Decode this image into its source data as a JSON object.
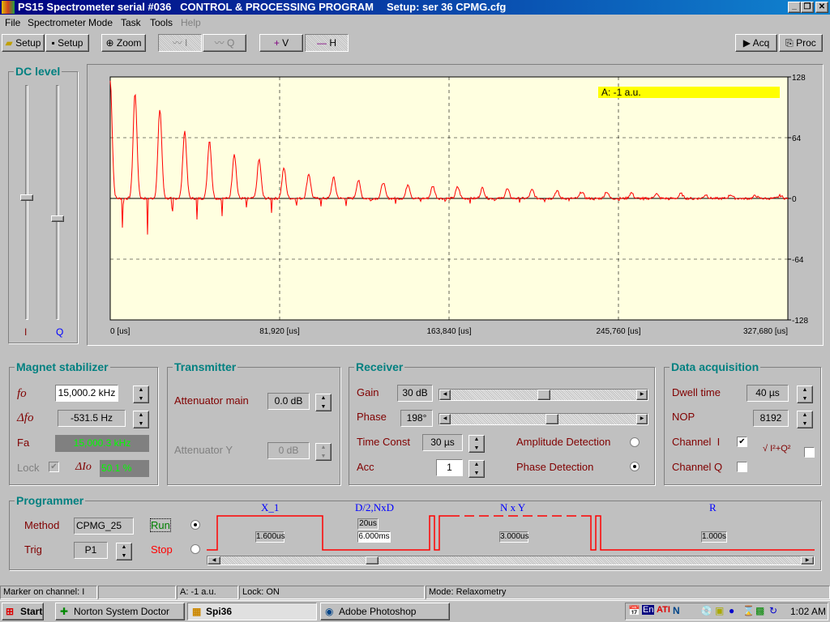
{
  "window": {
    "title": "PS15 Spectrometer serial #036   CONTROL & PROCESSING PROGRAM",
    "setup": "Setup: ser 36 CPMG.cfg",
    "controls": [
      "_",
      "❐",
      "✕"
    ]
  },
  "menu": [
    "File",
    "Spectrometer",
    "Mode",
    "Task",
    "Tools",
    "Help"
  ],
  "toolbar": {
    "open_setup": "Setup",
    "save_setup": "Setup",
    "zoom": "Zoom",
    "channel_i": "I",
    "channel_q": "Q",
    "cursor_v": "V",
    "cursor_h": "H",
    "acq": "Acq",
    "proc": "Proc"
  },
  "dc_level": {
    "title": "DC level",
    "i_label": "I",
    "q_label": "Q",
    "i_level": 0.48,
    "q_level": 0.57
  },
  "chart_data": {
    "type": "line",
    "xlim": [
      0,
      327680
    ],
    "ylim": [
      -128,
      128
    ],
    "x_ticks": [
      "0 [us]",
      "81,920 [us]",
      "163,840 [us]",
      "245,760 [us]",
      "327,680 [us]"
    ],
    "y_ticks": [
      "128",
      "64",
      "0",
      "-64",
      "-128"
    ],
    "grid": true,
    "marker_readout": "A: -1 a.u.",
    "echo_spacing_us": 12000,
    "echo_amplitudes": [
      124,
      111,
      94,
      71,
      61,
      47,
      41,
      32,
      26,
      22,
      19,
      17,
      15,
      13,
      12,
      11,
      10,
      9,
      8,
      7,
      7,
      6,
      5,
      5,
      4,
      4,
      3,
      3
    ],
    "colors": {
      "trace": "#ff0000",
      "background": "#ffffe0",
      "marker": "#ffff00"
    }
  },
  "magnet": {
    "title": "Magnet stabilizer",
    "fo_label": "fo",
    "fo": "15,000.2 kHz",
    "dfo_label": "Δfo",
    "dfo": "-531.5 Hz",
    "fa_label": "Fa",
    "fa": "15,000.3 kHz",
    "lock_label": "Lock",
    "dio_label": "ΔIo",
    "dio": "50.1 %"
  },
  "transmitter": {
    "title": "Transmitter",
    "att_main_label": "Attenuator main",
    "att_main": "0.0 dB",
    "att_y_label": "Attenuator Y",
    "att_y": "0 dB"
  },
  "receiver": {
    "title": "Receiver",
    "gain_label": "Gain",
    "gain": "30 dB",
    "gain_pos": 0.5,
    "phase_label": "Phase",
    "phase": "198°",
    "phase_pos": 0.55,
    "tc_label": "Time Const",
    "tc": "30 µs",
    "acc_label": "Acc",
    "acc": "1",
    "amp_det": "Amplitude Detection",
    "phase_det": "Phase Detection"
  },
  "acquisition": {
    "title": "Data acquisition",
    "dwell_label": "Dwell time",
    "dwell": "40 µs",
    "nop_label": "NOP",
    "nop": "8192",
    "ch_i": "Channel  I",
    "ch_q": "Channel Q",
    "mag": "√ I²+Q²"
  },
  "programmer": {
    "title": "Programmer",
    "method_label": "Method",
    "method": "CPMG_25",
    "trig_label": "Trig",
    "trig": "P1",
    "run": "Run",
    "stop": "Stop",
    "seg_x1": "X_1",
    "seg_d": "D/2,NxD",
    "seg_nxy": "N x Y",
    "seg_r": "R",
    "x1_val": "1.600us",
    "d_val1": "20us",
    "d_val2": "6.000ms",
    "nxy_val": "3.000us",
    "r_val": "1.000s"
  },
  "statusbar": [
    "Marker on channel:  I",
    "",
    "A: -1 a.u.",
    "Lock: ON",
    "Mode: Relaxometry"
  ],
  "taskbar": {
    "start": "Start",
    "tasks": [
      "Norton System Doctor",
      "Spi36",
      "Adobe Photoshop"
    ],
    "lang": "En",
    "clock": "1:02 AM"
  }
}
